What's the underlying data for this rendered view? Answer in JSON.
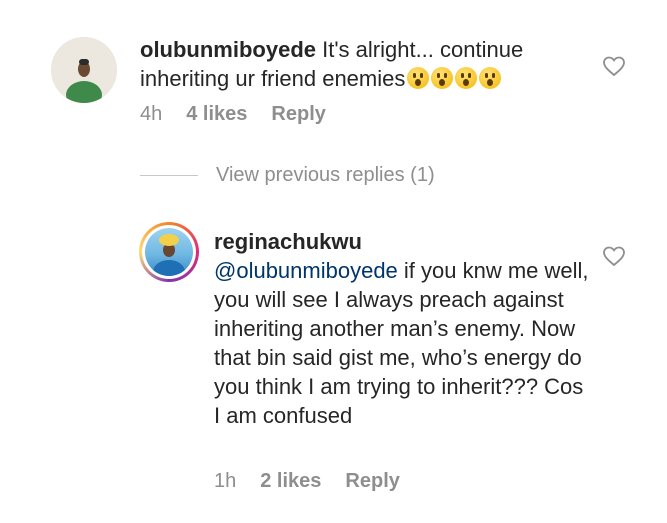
{
  "comment": {
    "username": "olubunmiboyede",
    "text": " It's alright... continue inheriting ur friend enemies",
    "emoji_count": 4,
    "time": "4h",
    "likes": "4 likes",
    "reply_label": "Reply"
  },
  "view_replies": "View previous replies (1)",
  "reply": {
    "username": "reginachukwu",
    "mention": "@olubunmiboyede",
    "text": " if you knw me well, you will see I always preach against inheriting another man’s enemy. Now that bin said gist me, who’s energy do you think I am trying to inherit??? Cos I am confused",
    "time": "1h",
    "likes": "2 likes",
    "reply_label": "Reply"
  },
  "colors": {
    "text": "#262626",
    "meta": "#8e8e8e",
    "mention": "#003569"
  },
  "icons": [
    "heart-icon",
    "astonished-emoji-icon"
  ]
}
